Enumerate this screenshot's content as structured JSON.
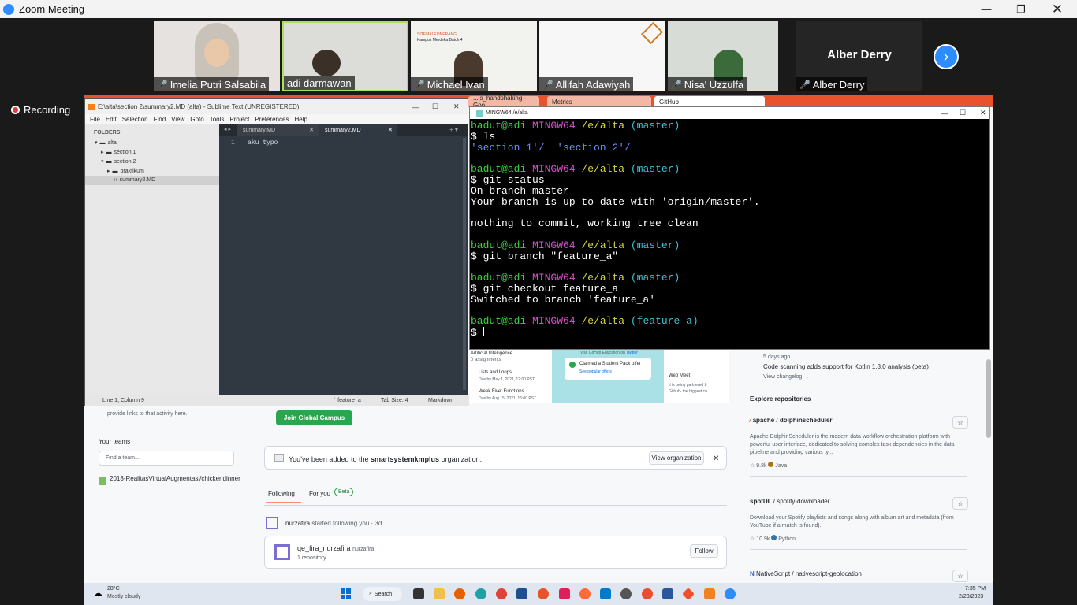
{
  "zoom": {
    "title": "Zoom Meeting",
    "recording": "Recording"
  },
  "participants": [
    {
      "name": "Imelia Putri Salsabila",
      "bg": "#e8e4e2"
    },
    {
      "name": "adi darmawan",
      "bg": "#dcdcd8"
    },
    {
      "name": "Michael Ivan",
      "bg": "#f2f2ef"
    },
    {
      "name": "Allifah Adawiyah",
      "bg": "#f7f7f7"
    },
    {
      "name": "Nisa' Uzzulfa",
      "bg": "#d8dcd6"
    },
    {
      "name": "Alber Derry",
      "bg": "#252525",
      "big": "Alber Derry"
    }
  ],
  "slide": {
    "line1": "SITEMALEONERANG",
    "line2": "Kampus Merdeka Batch 4"
  },
  "browser": {
    "tabs": [
      "...ls_handshaking - Goo",
      "Metrics",
      "GitHub"
    ]
  },
  "sublime": {
    "title": "E:\\alta\\section 2\\summary2.MD (alta) - Sublime Text (UNREGISTERED)",
    "menu": [
      "File",
      "Edit",
      "Selection",
      "Find",
      "View",
      "Goto",
      "Tools",
      "Project",
      "Preferences",
      "Help"
    ],
    "folders_label": "FOLDERS",
    "tree": [
      "alta",
      "section 1",
      "section 2",
      "praktikum",
      "summary2.MD"
    ],
    "tabs": [
      "summary.MD",
      "summary2.MD"
    ],
    "line_no": "1",
    "code": "aku typo",
    "status_left": "Line 1, Column 9",
    "status_branch": "feature_a",
    "status_tab": "Tab Size: 4",
    "status_syntax": "Markdown"
  },
  "terminal": {
    "title": "MINGW64:/e/alta",
    "user": "badut@adi",
    "env": "MINGW64",
    "path": "/e/alta",
    "br1": "(master)",
    "br2": "(feature_a)",
    "cmd_ls": "$ ls",
    "ls_out1": "'section 1'/",
    "ls_out2": "'section 2'/",
    "cmd_status": "$ git status",
    "status_out1": "On branch master",
    "status_out2": "Your branch is up to date with 'origin/master'.",
    "status_out3": "nothing to commit, working tree clean",
    "cmd_branch": "$ git branch \"feature_a\"",
    "cmd_checkout": "$ git checkout feature_a",
    "checkout_out": "Switched to branch 'feature_a'",
    "prompt": "$ "
  },
  "github": {
    "left_text": "provide links to that activity here.",
    "teams_label": "Your teams",
    "team_placeholder": "Find a team...",
    "team_item": "2018-RealitasVirtualAugmentasi/chickendinner",
    "join_btn": "Join Global Campus",
    "org_msg": "You've been added to the",
    "org_name": "smartsystemkmplus",
    "org_suffix": "organization.",
    "view_org": "View organization",
    "feed_tabs": [
      "Following",
      "For you"
    ],
    "beta": "Beta",
    "follow_event": "nurzafira",
    "follow_text": "started following you · 3d",
    "user_card_name": "qe_fira_nurzafira",
    "user_card_login": "nurzafira",
    "user_card_repos": "1 repository",
    "follow_btn": "Follow",
    "edu": {
      "ai": "Artificial Intelligence",
      "ai_sub": "0 assignments",
      "loops": "Lists and Loops",
      "loops_due": "Due by May 1, 2021, 12:00 PST",
      "week5": "Week Five: Functions",
      "week5_due": "Due by Aug 15, 2021, 16:00 PST",
      "visit": "Visit GitHub Education on",
      "twitter": "Twitter",
      "claimed": "Claimed a Student Pack offer",
      "popular": "See popular offers",
      "web_meet": "Web Meet",
      "partner": "It is being partnered b",
      "biggest": "Github- the biggest co"
    },
    "changelog": {
      "ago": "5 days ago",
      "text": "Code scanning adds support for Kotlin 1.8.0 analysis (beta)",
      "link": "View changelog →"
    },
    "explore_label": "Explore repositories",
    "repos": [
      {
        "owner": "apache",
        "name": "dolphinscheduler",
        "desc": "Apache DolphinScheduler is the modern data workflow orchestration platform with powerful user interface, dedicated to solving complex task dependencies in the data pipeline and providing various ty...",
        "stars": "9.8k",
        "lang": "Java",
        "lang_color": "#b07219"
      },
      {
        "owner": "spotDL",
        "name": "spotify-downloader",
        "desc": "Download your Spotify playlists and songs along with album art and metadata (from YouTube if a match is found).",
        "stars": "10.9k",
        "lang": "Python",
        "lang_color": "#3572a5"
      },
      {
        "owner": "NativeScript",
        "name": "nativescript-geolocation",
        "desc": "",
        "stars": "",
        "lang": "",
        "lang_color": "#000000"
      }
    ]
  },
  "taskbar": {
    "temp": "28°C",
    "weather": "Mostly cloudy",
    "search": "Search",
    "time": "7:35 PM",
    "date": "2/20/2023"
  }
}
